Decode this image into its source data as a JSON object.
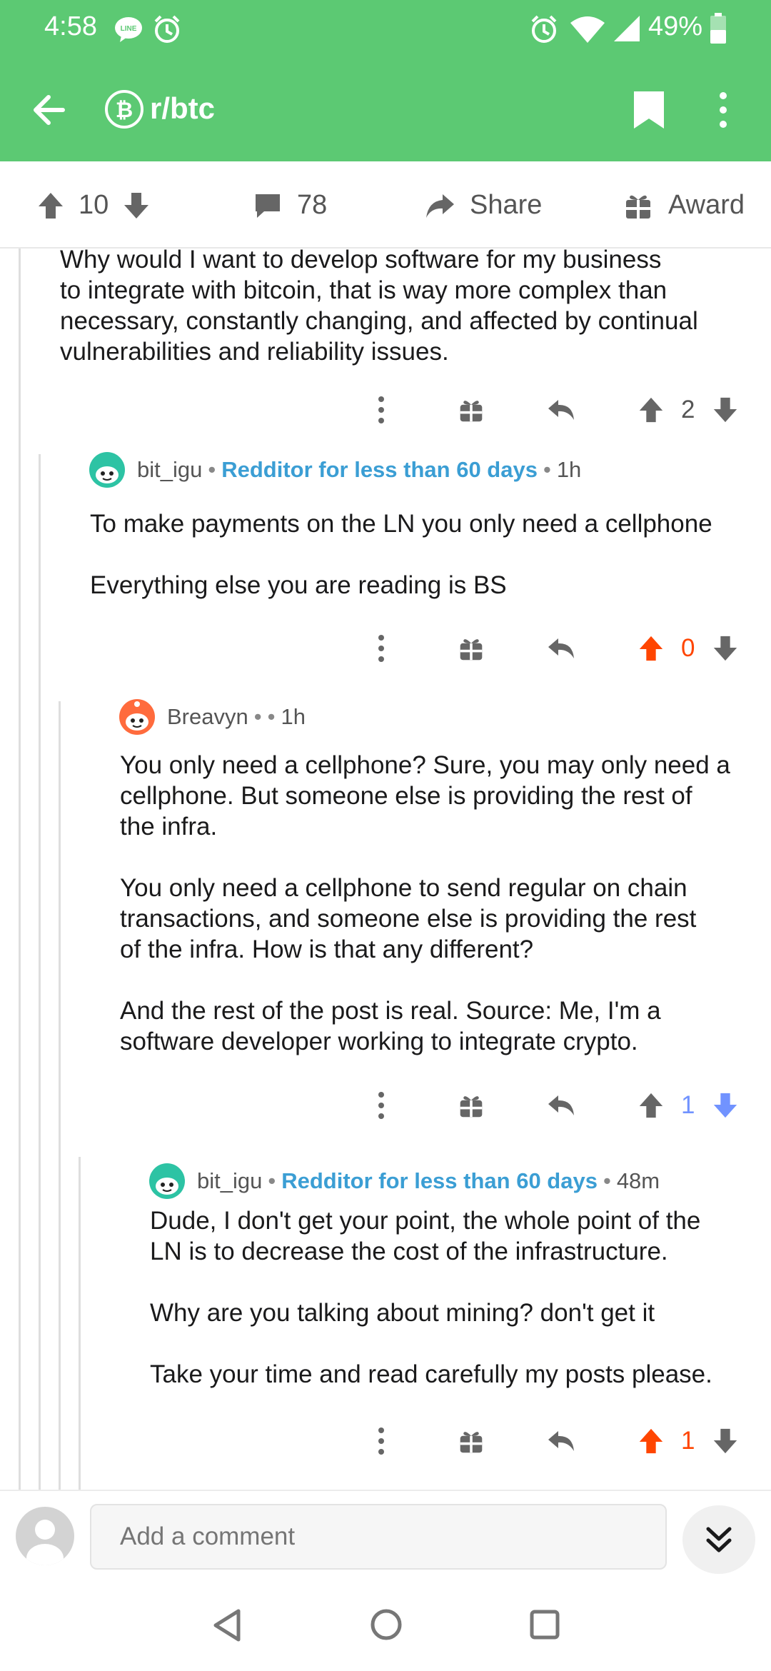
{
  "status_bar": {
    "time": "4:58",
    "battery": "49%",
    "icons": [
      "line-icon",
      "alarm-icon",
      "alarm-icon",
      "wifi-icon",
      "signal-icon",
      "battery-icon"
    ]
  },
  "app_bar": {
    "subreddit": "r/btc",
    "icons": [
      "back-arrow-icon",
      "bitcoin-icon",
      "bookmark-icon",
      "more-vertical-icon"
    ]
  },
  "post_bar": {
    "score": "10",
    "comments": "78",
    "share_label": "Share",
    "award_label": "Award"
  },
  "comments": [
    {
      "text": "Why would I want to develop software for my business\nto integrate with bitcoin, that is way more complex than\nnecessary, constantly changing, and affected by continual\nvulnerabilities and reliability issues.",
      "score": "2",
      "vote_state": "none"
    },
    {
      "author": "bit_igu",
      "flair": "Redditor for less than 60 days",
      "age": "1h",
      "text": "To make payments on the LN you only need a cellphone\n\nEverything else you are reading is BS",
      "score": "0",
      "vote_state": "up"
    },
    {
      "author": "Breavyn",
      "flair": "",
      "age": "1h",
      "text": "You only need a cellphone? Sure, you may only need a\ncellphone. But someone else is providing the rest of\nthe infra.\n\nYou only need a cellphone to send regular on chain\ntransactions, and someone else is providing the rest\nof the infra. How is that any different?\n\nAnd the rest of the post is real. Source: Me, I'm a\nsoftware developer working to integrate crypto.",
      "score": "1",
      "vote_state": "down"
    },
    {
      "author": "bit_igu",
      "flair": "Redditor for less than 60 days",
      "age": "48m",
      "text": "Dude, I don't get your point, the whole point of the\nLN is to decrease the cost of the infrastructure.\n\nWhy are you talking about mining? don't get it\n\nTake your time and read carefully my posts please.",
      "score": "1",
      "vote_state": "up"
    }
  ],
  "composer": {
    "placeholder": "Add a comment"
  },
  "colors": {
    "app_bar": "#5cc973",
    "upvote": "#ff4500",
    "downvote": "#7193ff",
    "flair": "#3b9ed4"
  }
}
